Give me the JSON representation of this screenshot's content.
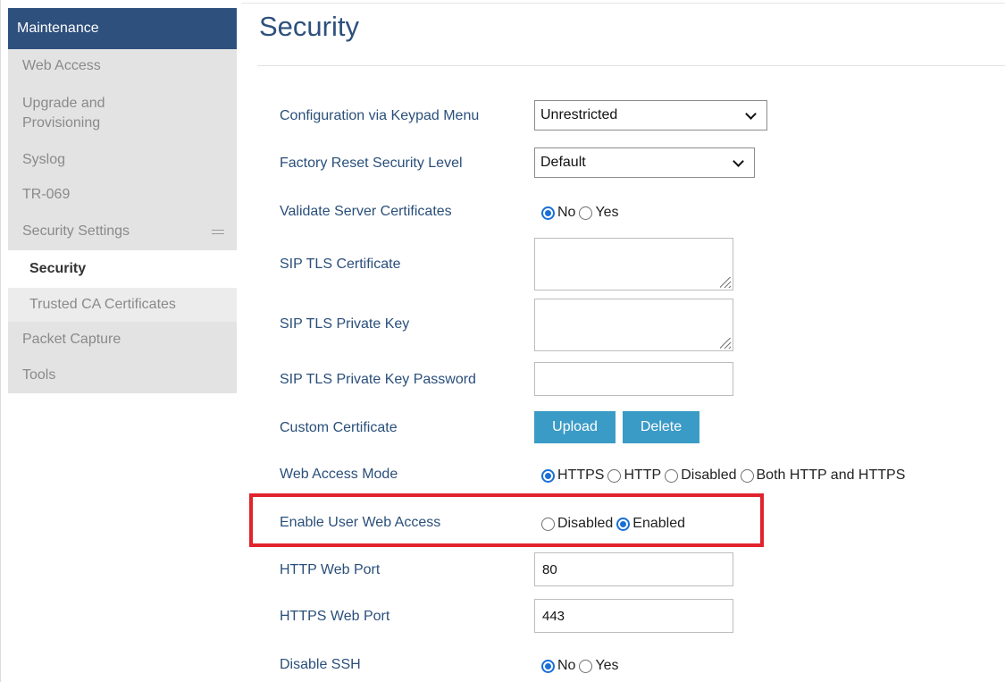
{
  "sidebar": {
    "header": "Maintenance",
    "items": [
      {
        "label": "Web Access"
      },
      {
        "label": "Upgrade and Provisioning"
      },
      {
        "label": "Syslog"
      },
      {
        "label": "TR-069"
      },
      {
        "label": "Security Settings"
      },
      {
        "label": "Packet Capture"
      },
      {
        "label": "Tools"
      }
    ],
    "sub_items": [
      {
        "label": "Security",
        "active": true
      },
      {
        "label": "Trusted CA Certificates",
        "active": false
      }
    ]
  },
  "page": {
    "title": "Security"
  },
  "form": {
    "keypad_menu": {
      "label": "Configuration via Keypad Menu",
      "value": "Unrestricted"
    },
    "factory_reset": {
      "label": "Factory Reset Security Level",
      "value": "Default"
    },
    "validate_certs": {
      "label": "Validate Server Certificates",
      "options": [
        "No",
        "Yes"
      ],
      "selected": "No"
    },
    "sip_tls_cert": {
      "label": "SIP TLS Certificate",
      "value": ""
    },
    "sip_tls_key": {
      "label": "SIP TLS Private Key",
      "value": ""
    },
    "sip_tls_key_password": {
      "label": "SIP TLS Private Key Password",
      "value": ""
    },
    "custom_cert": {
      "label": "Custom Certificate",
      "upload_label": "Upload",
      "delete_label": "Delete"
    },
    "web_access_mode": {
      "label": "Web Access Mode",
      "options": [
        "HTTPS",
        "HTTP",
        "Disabled",
        "Both HTTP and HTTPS"
      ],
      "selected": "HTTPS"
    },
    "user_web_access": {
      "label": "Enable User Web Access",
      "options": [
        "Disabled",
        "Enabled"
      ],
      "selected": "Enabled"
    },
    "http_port": {
      "label": "HTTP Web Port",
      "value": "80"
    },
    "https_port": {
      "label": "HTTPS Web Port",
      "value": "443"
    },
    "disable_ssh": {
      "label": "Disable SSH",
      "options": [
        "No",
        "Yes"
      ],
      "selected": "No"
    }
  },
  "colors": {
    "sidebar_header": "#2e507d",
    "button": "#3b9bc7",
    "radio_selected": "#1a6fd6",
    "highlight": "#e0232c"
  }
}
